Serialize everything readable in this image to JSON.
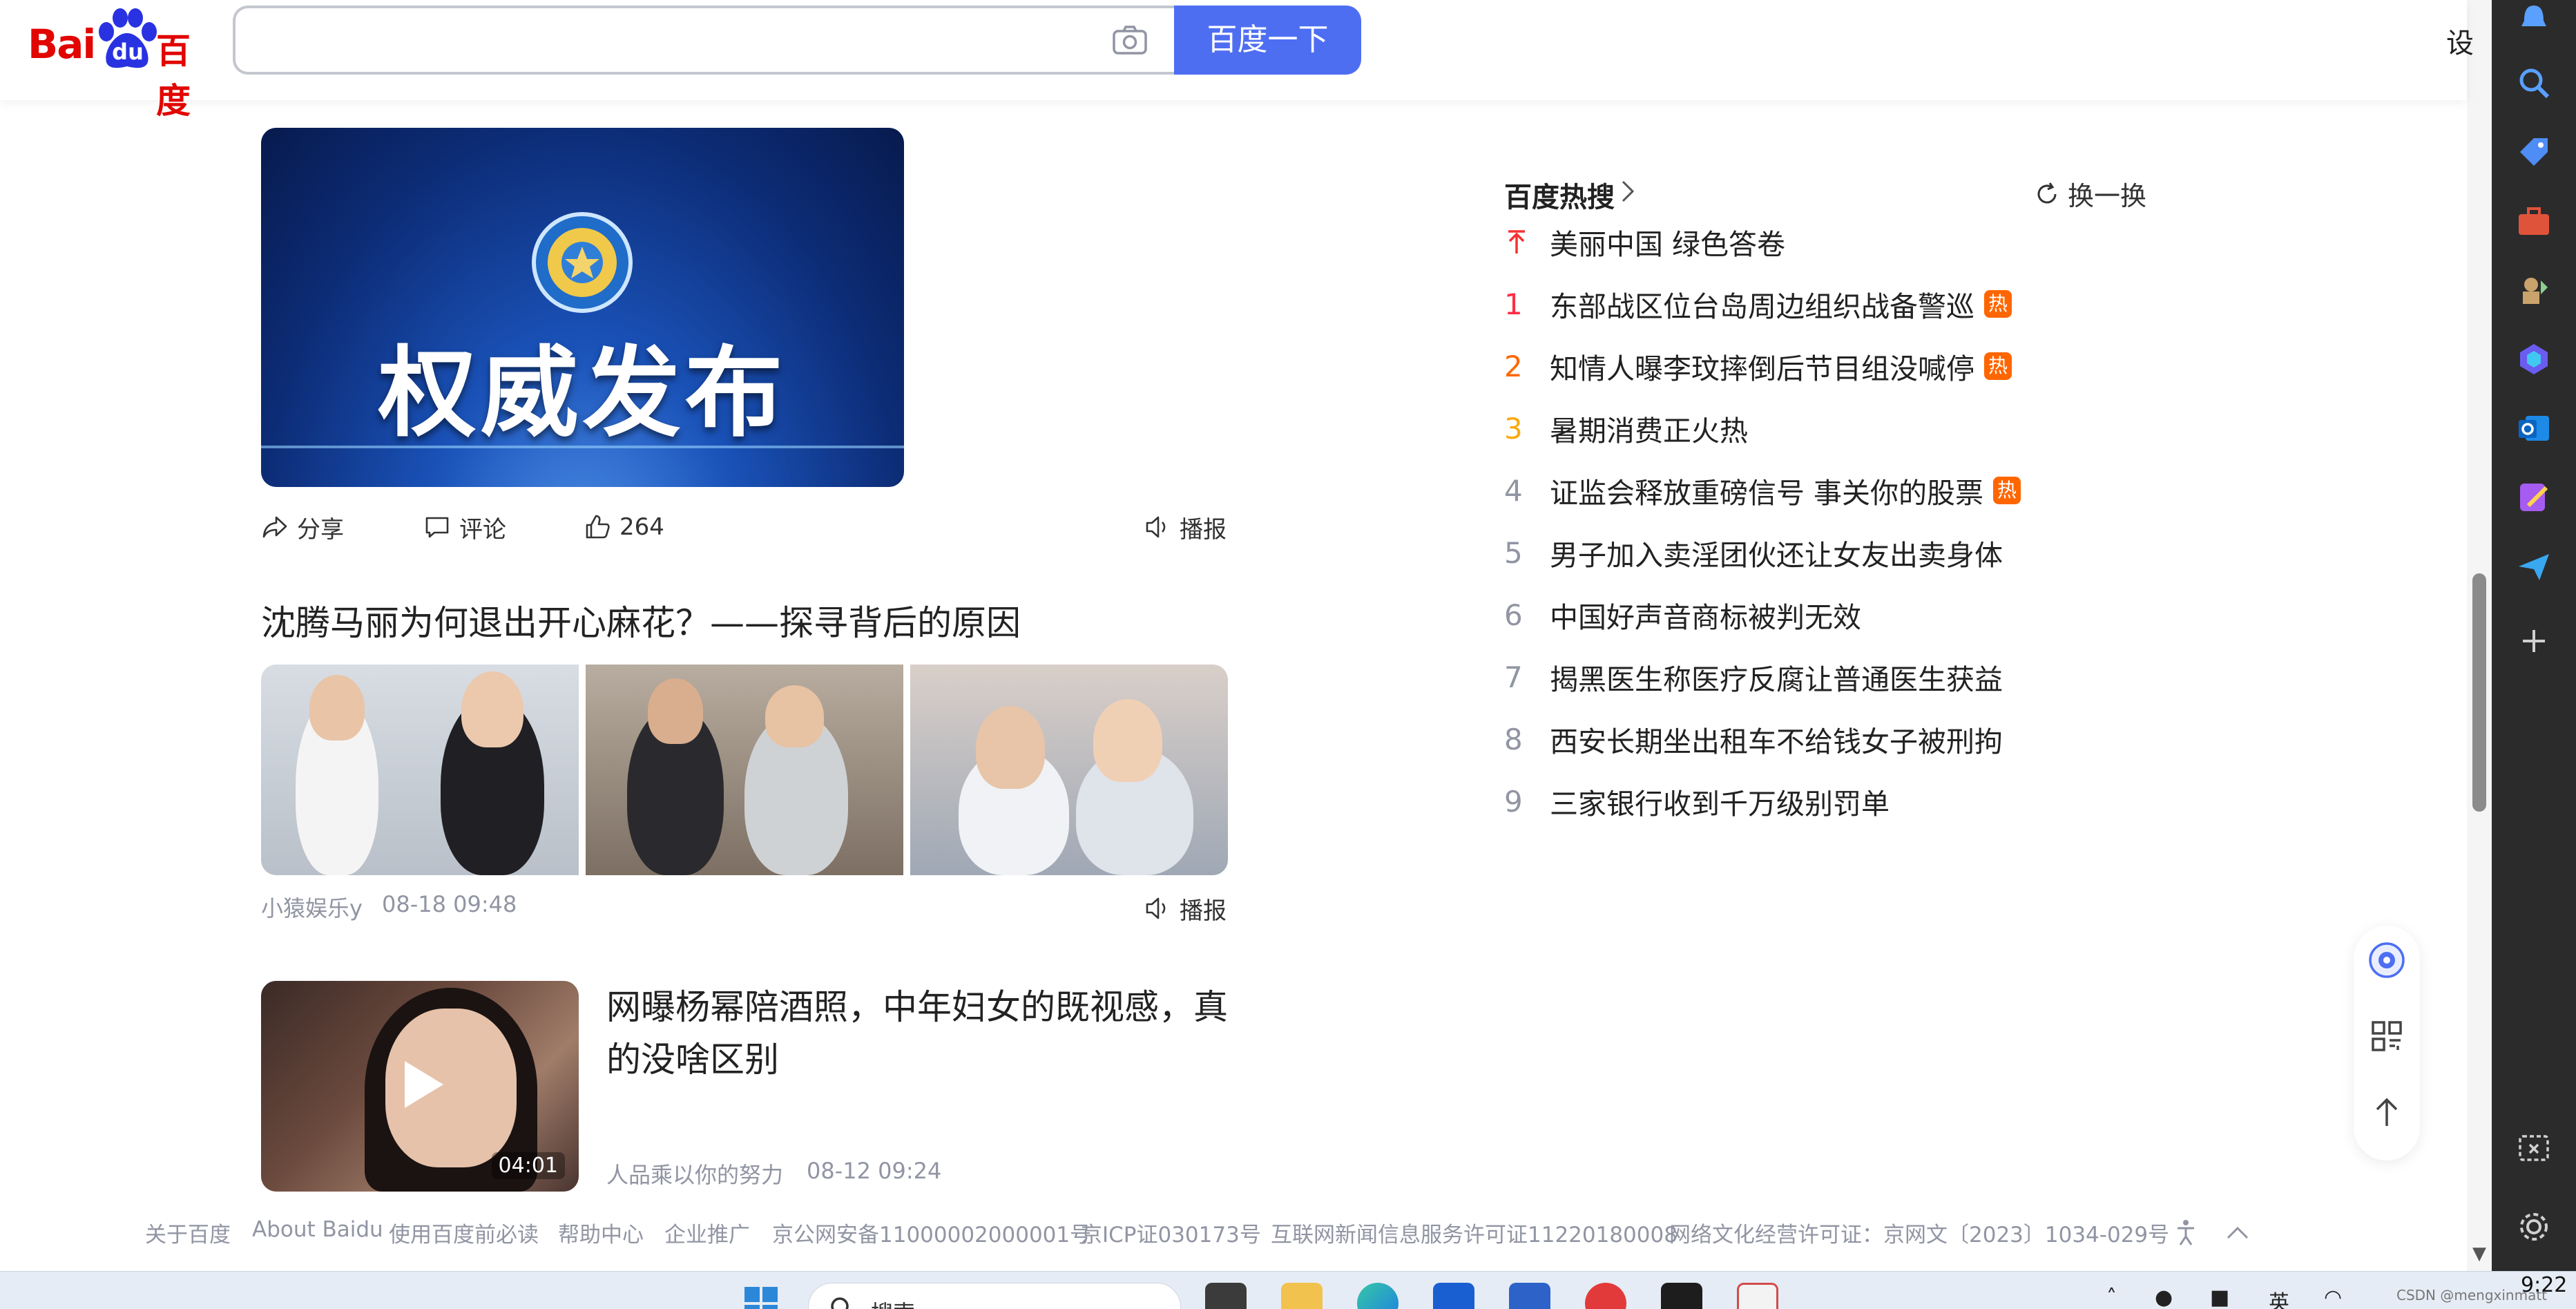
{
  "header": {
    "logo_bai": "Bai",
    "logo_du": "du",
    "logo_cn": "百度",
    "search_value": "",
    "search_button": "百度一下",
    "settings_cut": "设"
  },
  "feed": {
    "card1": {
      "image_text": "权威发布",
      "share": "分享",
      "comment": "评论",
      "likes": "264",
      "broadcast": "播报"
    },
    "article2": {
      "title": "沈腾马丽为何退出开心麻花？——探寻背后的原因",
      "source": "小猿娱乐y",
      "time": "08-18 09:48",
      "broadcast": "播报"
    },
    "video": {
      "duration": "04:01",
      "title": "网曝杨幂陪酒照，中年妇女的既视感，真的没啥区别",
      "source": "人品乘以你的努力",
      "time": "08-12 09:24"
    }
  },
  "hot_search": {
    "title": "百度热搜",
    "refresh": "换一换",
    "badge": "热",
    "items": [
      {
        "rank": "",
        "text": "美丽中国 绿色答卷",
        "hot": false
      },
      {
        "rank": "1",
        "text": "东部战区位台岛周边组织战备警巡",
        "hot": true
      },
      {
        "rank": "2",
        "text": "知情人曝李玟摔倒后节目组没喊停",
        "hot": true
      },
      {
        "rank": "3",
        "text": "暑期消费正火热",
        "hot": false
      },
      {
        "rank": "4",
        "text": "证监会释放重磅信号 事关你的股票",
        "hot": true
      },
      {
        "rank": "5",
        "text": "男子加入卖淫团伙还让女友出卖身体",
        "hot": false
      },
      {
        "rank": "6",
        "text": "中国好声音商标被判无效",
        "hot": false
      },
      {
        "rank": "7",
        "text": "揭黑医生称医疗反腐让普通医生获益",
        "hot": false
      },
      {
        "rank": "8",
        "text": "西安长期坐出租车不给钱女子被刑拘",
        "hot": false
      },
      {
        "rank": "9",
        "text": "三家银行收到千万级别罚单",
        "hot": false
      }
    ],
    "rank_colors": {
      "top": "#f73131",
      "r1": "#fe2d46",
      "r2": "#f60",
      "r3": "#faa90e",
      "other": "#9195a3"
    }
  },
  "footer": {
    "links": [
      "关于百度",
      "About Baidu",
      "使用百度前必读",
      "帮助中心",
      "企业推广",
      "京公网安备11000002000001号",
      "京ICP证030173号",
      "互联网新闻信息服务许可证11220180008",
      "网络文化经营许可证：京网文〔2023〕1034-029号"
    ]
  },
  "taskbar": {
    "search_placeholder": "搜索",
    "ime": "英",
    "time": "9:22",
    "watermark": "CSDN @mengxinmatt"
  },
  "colors": {
    "brand_red": "#e10601",
    "brand_blue": "#4e6ef2",
    "hot_badge": "#ff6600"
  }
}
